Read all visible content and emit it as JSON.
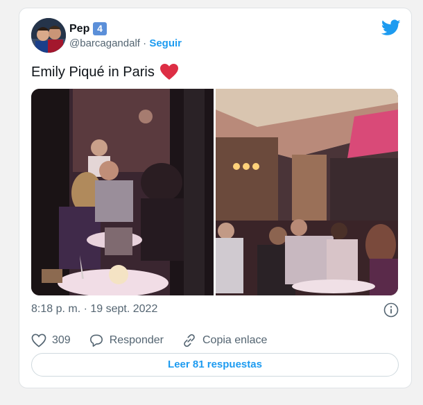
{
  "tweet": {
    "author_name": "Pep",
    "badge": "4",
    "handle": "@barcagandalf",
    "separator": "·",
    "follow_label": "Seguir",
    "text": "Emily Piqué in Paris",
    "timestamp": "8:18 p. m. · 19 sept. 2022",
    "like_count": "309",
    "reply_label": "Responder",
    "copy_link_label": "Copia enlace",
    "read_replies_label": "Leer 81 respuestas"
  },
  "icons": {
    "brand": "twitter-bird-icon",
    "emoji": "red-heart-icon",
    "info": "info-icon",
    "like": "heart-outline-icon",
    "reply": "speech-bubble-icon",
    "copy_link": "link-icon"
  },
  "colors": {
    "accent": "#1d9bf0",
    "secondary_text": "#536471",
    "heart": "#e0245e",
    "badge": "#5b8fd9"
  }
}
